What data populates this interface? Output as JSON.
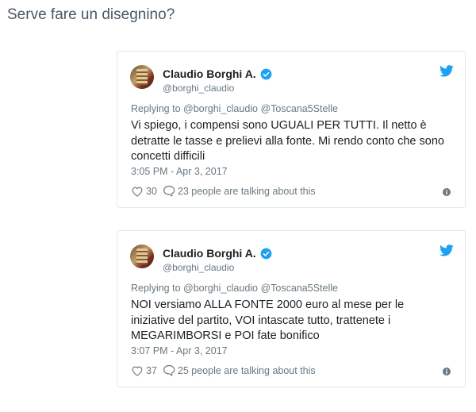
{
  "page": {
    "heading": "Serve fare un disegnino?"
  },
  "colors": {
    "twitter_blue": "#1da1f2",
    "text_gray": "#697882",
    "border": "#e1e8ed"
  },
  "tweets": [
    {
      "author_name": "Claudio Borghi A.",
      "handle": "@borghi_claudio",
      "replying_to": "Replying to @borghi_claudio @Toscana5Stelle",
      "text": "Vi spiego, i compensi sono UGUALI PER TUTTI. Il netto è detratte le tasse e prelievi alla fonte. Mi rendo conto che sono concetti difficili",
      "timestamp": "3:05 PM - Apr 3, 2017",
      "likes": "30",
      "talking": "23 people are talking about this",
      "icons": [
        "avatar",
        "verified-badge-icon",
        "twitter-bird-icon",
        "heart-icon",
        "comment-bubble-icon",
        "info-icon"
      ]
    },
    {
      "author_name": "Claudio Borghi A.",
      "handle": "@borghi_claudio",
      "replying_to": "Replying to @borghi_claudio @Toscana5Stelle",
      "text": "NOI versiamo ALLA FONTE 2000 euro al mese per le iniziative del partito, VOI intascate tutto, trattenete i MEGARIMBORSI e POI fate bonifico",
      "timestamp": "3:07 PM - Apr 3, 2017",
      "likes": "37",
      "talking": "25 people are talking about this",
      "icons": [
        "avatar",
        "verified-badge-icon",
        "twitter-bird-icon",
        "heart-icon",
        "comment-bubble-icon",
        "info-icon"
      ]
    }
  ]
}
